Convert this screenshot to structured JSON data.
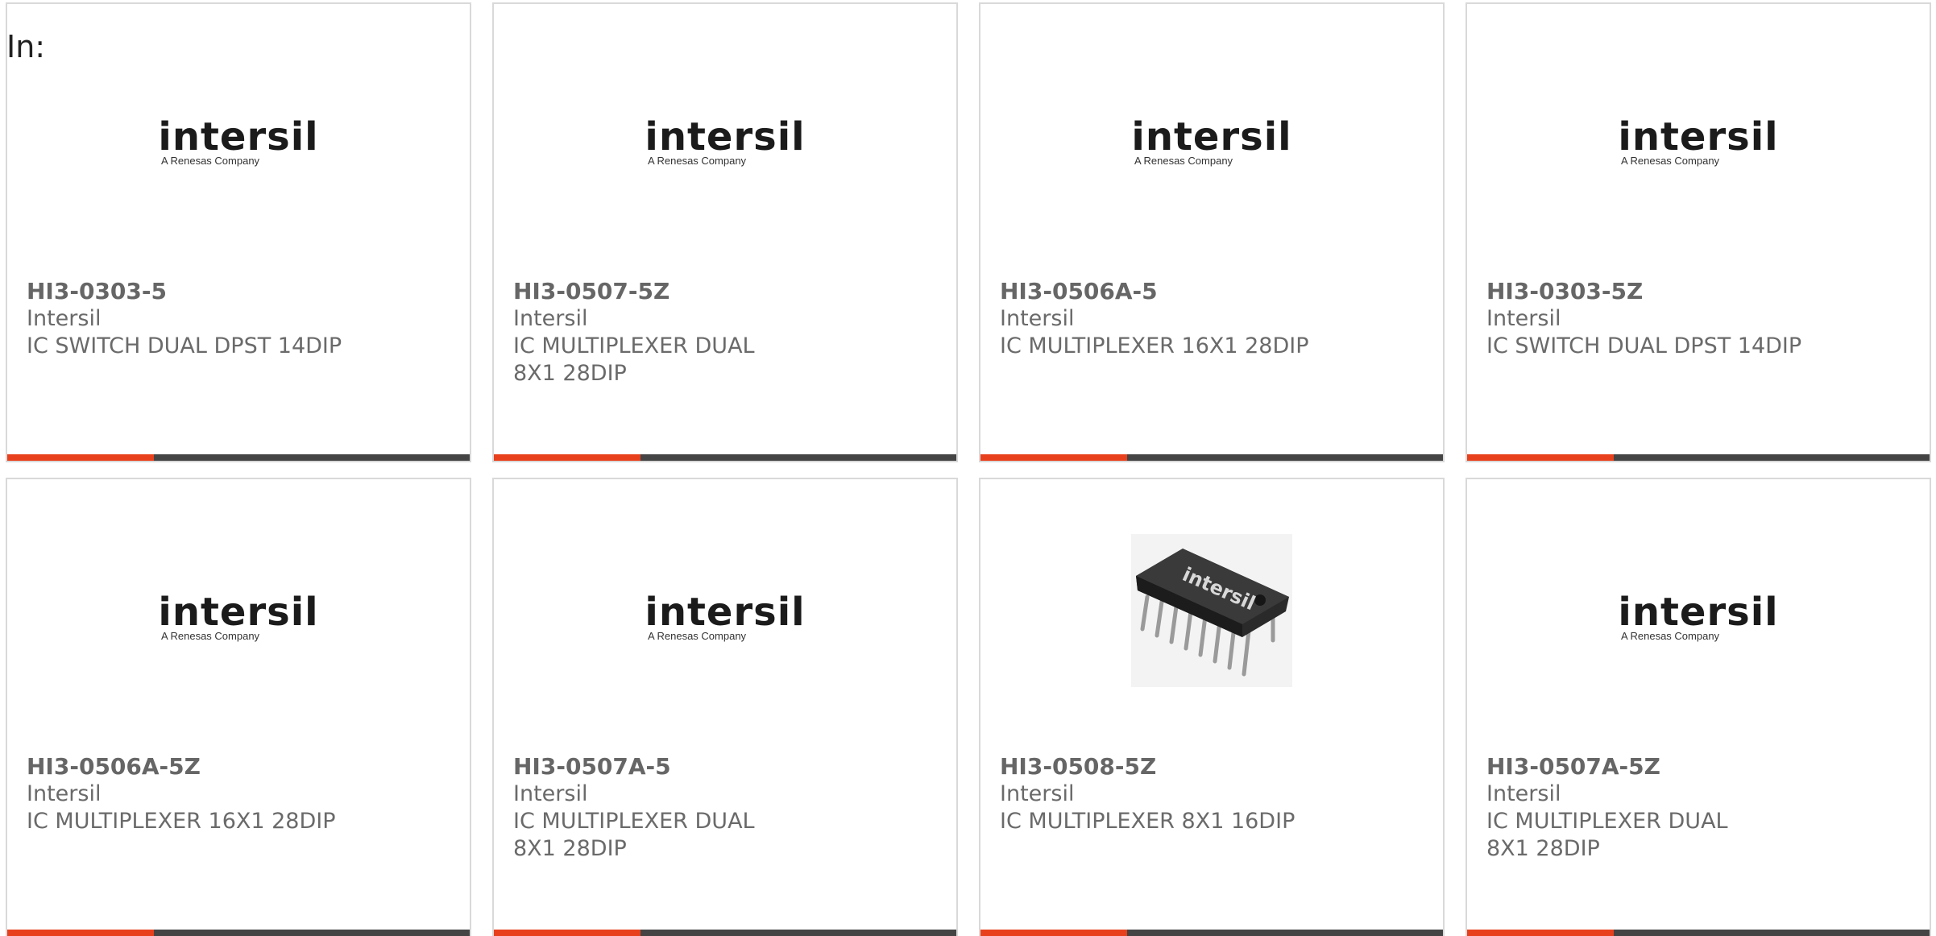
{
  "filter": {
    "label": "In:"
  },
  "products": [
    {
      "part": "HI3-0303-5",
      "maker": "Intersil",
      "desc": "IC SWITCH DUAL DPST 14DIP",
      "image": "intersil-logo"
    },
    {
      "part": "HI3-0507-5Z",
      "maker": "Intersil",
      "desc": "IC MULTIPLEXER DUAL 8X1 28DIP",
      "image": "intersil-logo"
    },
    {
      "part": "HI3-0506A-5",
      "maker": "Intersil",
      "desc": "IC MULTIPLEXER 16X1 28DIP",
      "image": "intersil-logo"
    },
    {
      "part": "HI3-0303-5Z",
      "maker": "Intersil",
      "desc": "IC SWITCH DUAL DPST 14DIP",
      "image": "intersil-logo"
    },
    {
      "part": "HI3-0506A-5Z",
      "maker": "Intersil",
      "desc": "IC MULTIPLEXER 16X1 28DIP",
      "image": "intersil-logo"
    },
    {
      "part": "HI3-0507A-5",
      "maker": "Intersil",
      "desc": "IC MULTIPLEXER DUAL 8X1 28DIP",
      "image": "intersil-logo"
    },
    {
      "part": "HI3-0508-5Z",
      "maker": "Intersil",
      "desc": "IC MULTIPLEXER 8X1 16DIP",
      "image": "dip-chip-photo"
    },
    {
      "part": "HI3-0507A-5Z",
      "maker": "Intersil",
      "desc": "IC MULTIPLEXER DUAL 8X1 28DIP",
      "image": "intersil-logo"
    }
  ],
  "logo": {
    "word": "intersil",
    "sub": "A Renesas Company"
  },
  "colors": {
    "accent": "#e8401c",
    "bar": "#444444",
    "border": "#d9d9d9",
    "text": "#6a6a6a"
  }
}
